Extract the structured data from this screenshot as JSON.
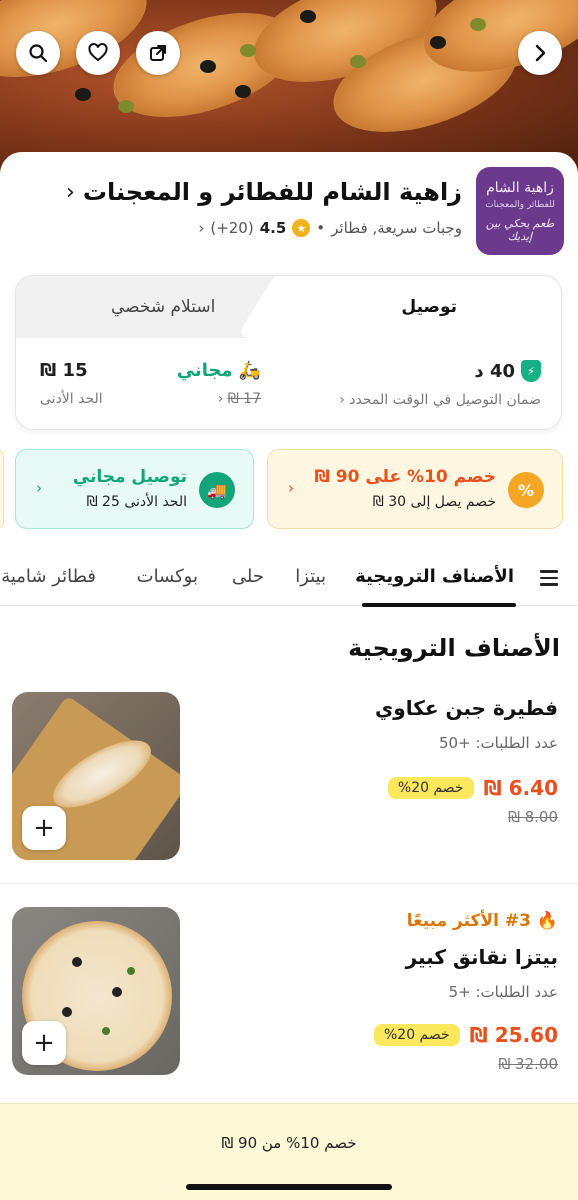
{
  "restaurant": {
    "name": "زاهية الشام للفطائر و المعجنات",
    "categories": "وجبات سريعة, فطائر",
    "rating": "4.5",
    "reviews": "(20+)",
    "logo": {
      "line1": "زاهية الشام",
      "line2": "للفطائر والمعجنات",
      "line3": "طعم يحكي بين إيديك"
    }
  },
  "delivery": {
    "tab_delivery": "توصيل",
    "tab_pickup": "استلام شخصي",
    "time": "40 د",
    "time_note": "ضمان التوصيل في الوقت المحدد",
    "fee": "مجاني",
    "fee_old": "17 ₪",
    "min": "15 ₪",
    "min_label": "الحد الأدنى"
  },
  "promos": [
    {
      "title": "خصم 10% على 90 ₪",
      "subtitle": "خصم يصل إلى 30 ₪",
      "color": "#e8501d"
    },
    {
      "title": "توصيل مجاني",
      "subtitle": "الحد الأدنى 25 ₪",
      "color": "#12a57a"
    }
  ],
  "tabs": [
    "الأصناف الترويجية",
    "بيتزا",
    "حلى",
    "بوكسات",
    "فطائر شامية"
  ],
  "section_title": "الأصناف الترويجية",
  "items": [
    {
      "name": "فطيرة  جبن عكاوي",
      "orders": "عدد الطلبات: +50",
      "price": "6.40 ₪",
      "discount": "خصم 20%",
      "old_price": "8.00 ₪"
    },
    {
      "badge": "#3 الأكثر مبيعًا",
      "name": "بيتزا نقانق كبير",
      "orders": "عدد الطلبات: +5",
      "price": "25.60 ₪",
      "discount": "خصم 20%",
      "old_price": "32.00 ₪"
    }
  ],
  "bottom_bar": {
    "text": "خصم 10% من 90 ₪"
  },
  "colors": {
    "accent_orange": "#e8501d",
    "green": "#12a57a",
    "promo_yellow": "#fbe85c"
  }
}
